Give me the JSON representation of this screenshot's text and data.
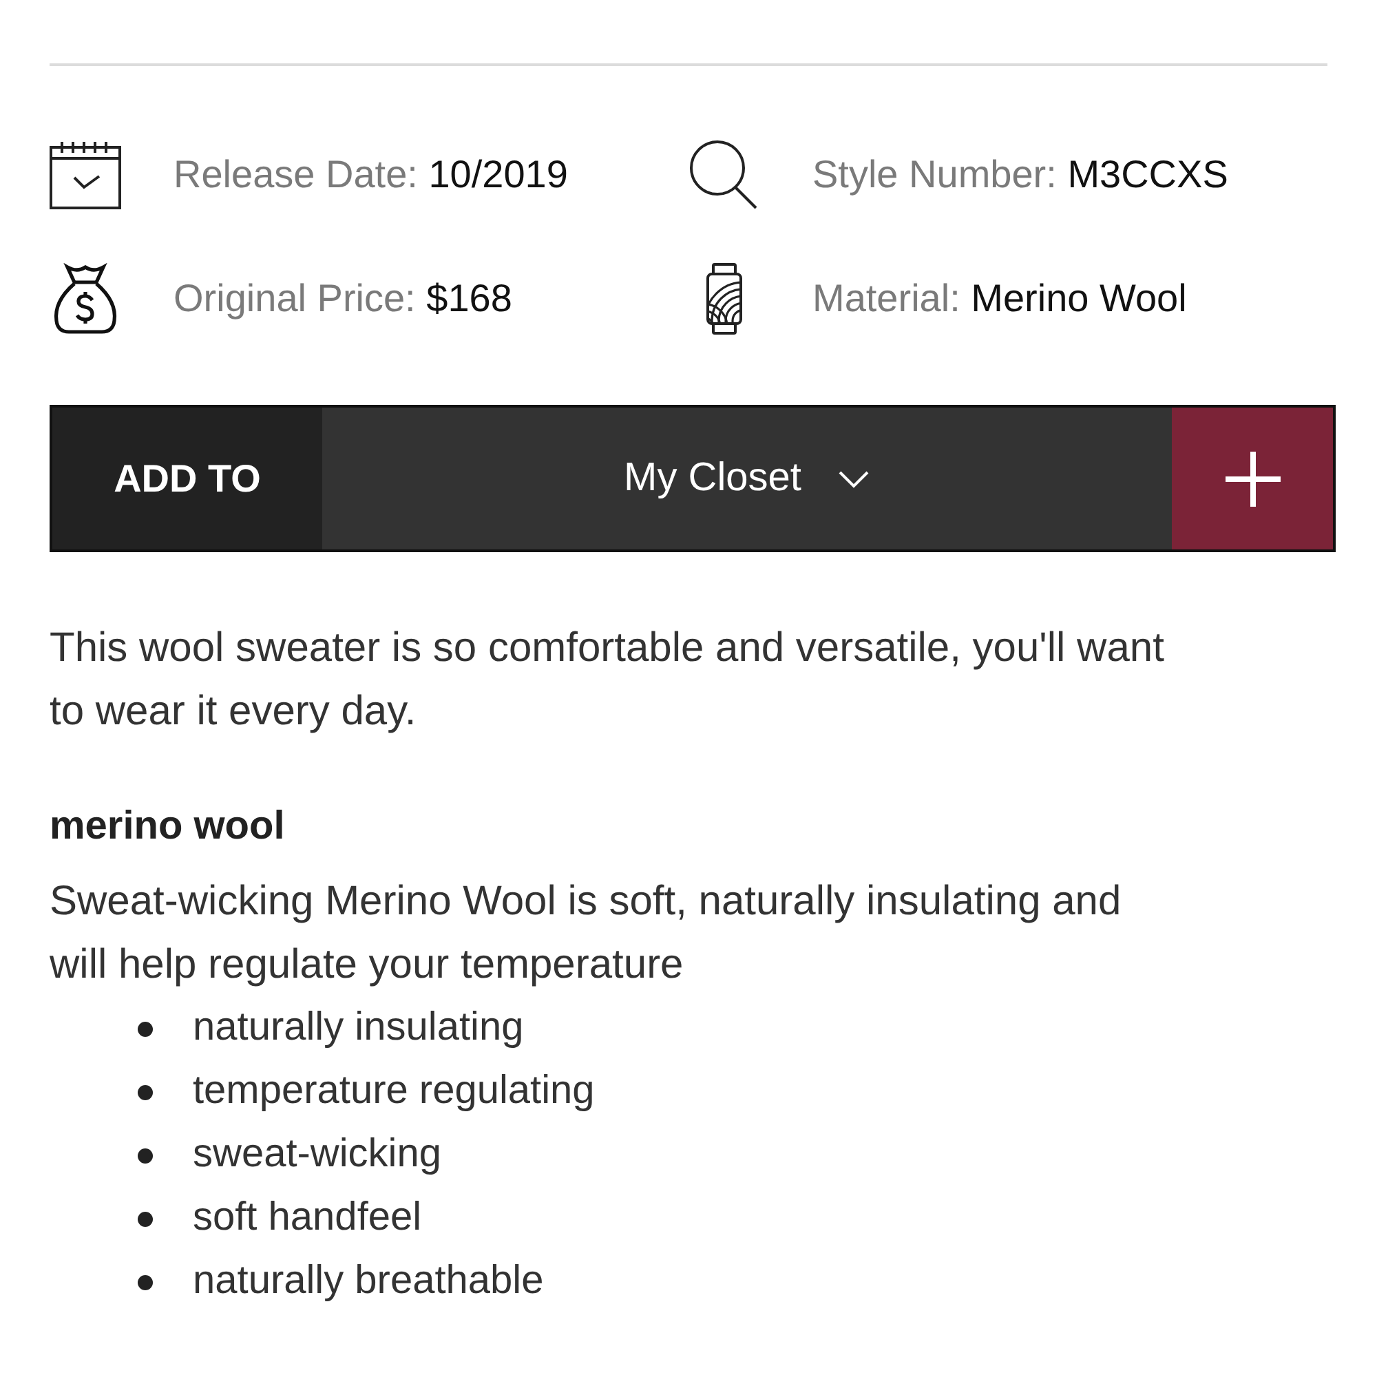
{
  "details": [
    {
      "kind": "calendar",
      "label": "Release Date:",
      "value": "10/2019"
    },
    {
      "kind": "search",
      "label": "Style Number:",
      "value": "M3CCXS"
    },
    {
      "kind": "money",
      "label": "Original Price:",
      "value": "$168"
    },
    {
      "kind": "yarn",
      "label": "Material:",
      "value": "Merino Wool"
    }
  ],
  "add_to": {
    "label": "ADD TO",
    "list": "My Closet"
  },
  "description": "This wool sweater is so comfortable and versatile, you'll want to wear it every day.",
  "feature": {
    "title": "merino wool",
    "text": "Sweat-wicking Merino Wool is soft, naturally insulating and will help regulate your temperature",
    "bullets": [
      "naturally insulating",
      "temperature regulating",
      "sweat-wicking",
      "soft handfeel",
      "naturally breathable"
    ]
  }
}
